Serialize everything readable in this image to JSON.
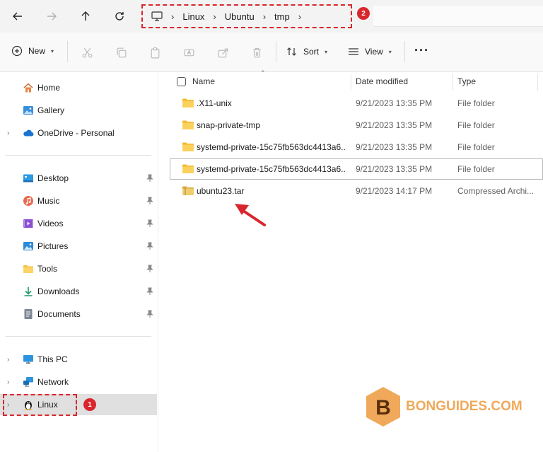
{
  "address_bar": {
    "crumbs": [
      "Linux",
      "Ubuntu",
      "tmp"
    ],
    "annotation_badge": "2"
  },
  "toolbar": {
    "new_label": "New",
    "sort_label": "Sort",
    "view_label": "View"
  },
  "sidebar": {
    "quick": [
      {
        "label": "Home",
        "icon": "home-icon"
      },
      {
        "label": "Gallery",
        "icon": "gallery-icon"
      },
      {
        "label": "OneDrive - Personal",
        "icon": "cloud-icon"
      }
    ],
    "pinned": [
      {
        "label": "Desktop",
        "icon": "desktop-icon"
      },
      {
        "label": "Music",
        "icon": "music-icon"
      },
      {
        "label": "Videos",
        "icon": "videos-icon"
      },
      {
        "label": "Pictures",
        "icon": "pictures-icon"
      },
      {
        "label": "Tools",
        "icon": "folder-icon"
      },
      {
        "label": "Downloads",
        "icon": "download-icon"
      },
      {
        "label": "Documents",
        "icon": "documents-icon"
      }
    ],
    "devices": [
      {
        "label": "This PC",
        "icon": "pc-icon"
      },
      {
        "label": "Network",
        "icon": "network-icon"
      },
      {
        "label": "Linux",
        "icon": "linux-penguin-icon"
      }
    ],
    "annotation_badge": "1"
  },
  "columns": {
    "name": "Name",
    "date": "Date modified",
    "type": "Type"
  },
  "files": [
    {
      "name": ".X11-unix",
      "date": "9/21/2023 13:35 PM",
      "type": "File folder",
      "kind": "folder"
    },
    {
      "name": "snap-private-tmp",
      "date": "9/21/2023 13:35 PM",
      "type": "File folder",
      "kind": "folder"
    },
    {
      "name": "systemd-private-15c75fb563dc4413a6...",
      "date": "9/21/2023 13:35 PM",
      "type": "File folder",
      "kind": "folder"
    },
    {
      "name": "systemd-private-15c75fb563dc4413a6...",
      "date": "9/21/2023 13:35 PM",
      "type": "File folder",
      "kind": "folder"
    },
    {
      "name": "ubuntu23.tar",
      "date": "9/21/2023 14:17 PM",
      "type": "Compressed Archi...",
      "kind": "archive"
    }
  ],
  "watermark": {
    "letter": "B",
    "text": "BONGUIDES.COM"
  },
  "colors": {
    "accent": "#0067c0",
    "annotation": "#d9262c",
    "folder": "#f4c042",
    "watermark": "#f0a95a"
  }
}
